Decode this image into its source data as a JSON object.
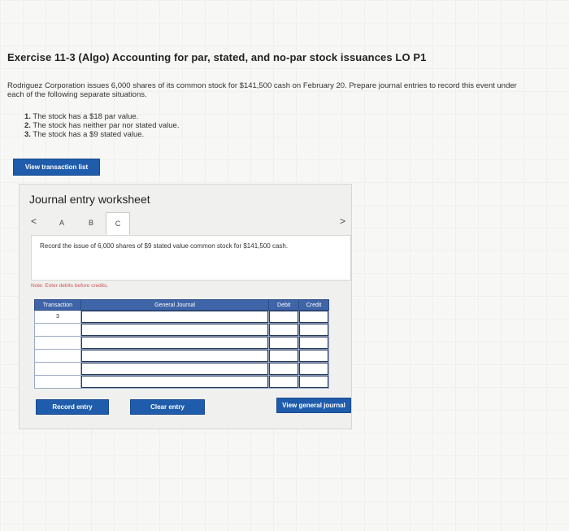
{
  "exercise": {
    "title": "Exercise 11-3 (Algo) Accounting for par, stated, and no-par stock issuances LO P1",
    "intro": "Rodriguez Corporation issues 6,000 shares of its common stock for $141,500 cash on February 20. Prepare journal entries to record this event under each of the following separate situations.",
    "requirements": [
      {
        "num": "1.",
        "text": "The stock has a $18 par value."
      },
      {
        "num": "2.",
        "text": "The stock has neither par nor stated value."
      },
      {
        "num": "3.",
        "text": "The stock has a $9 stated value."
      }
    ]
  },
  "buttons": {
    "view_transaction_list": "View transaction list",
    "record_entry": "Record entry",
    "clear_entry": "Clear entry",
    "view_general_journal": "View general journal"
  },
  "worksheet": {
    "title": "Journal entry worksheet",
    "tabs": [
      "A",
      "B",
      "C"
    ],
    "active_tab": "C",
    "prev_symbol": "<",
    "next_symbol": ">",
    "description": "Record the issue of 6,000 shares of $9 stated value common stock for $141,500 cash.",
    "note": "Note: Enter debits before credits.",
    "table": {
      "headers": [
        "Transaction",
        "General Journal",
        "Debit",
        "Credit"
      ],
      "transaction_number": "3"
    }
  },
  "colors": {
    "button_blue": "#1f5cab",
    "table_header": "#3f64a8",
    "note_red": "#c55"
  }
}
